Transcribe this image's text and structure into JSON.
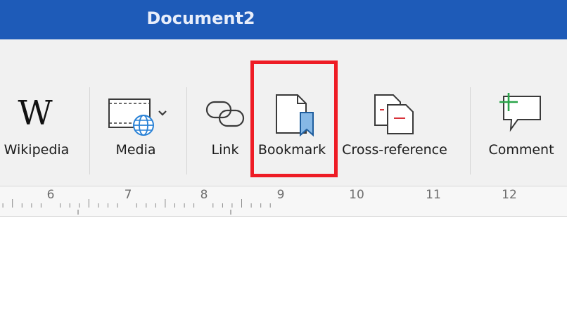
{
  "window": {
    "title": "Document2"
  },
  "ribbon": {
    "buttons": [
      {
        "id": "wikipedia",
        "label": "Wikipedia",
        "icon": "wikipedia-icon",
        "glyph": "W"
      },
      {
        "id": "media",
        "label": "Media",
        "icon": "media-icon"
      },
      {
        "id": "link",
        "label": "Link",
        "icon": "link-icon"
      },
      {
        "id": "bookmark",
        "label": "Bookmark",
        "icon": "bookmark-icon"
      },
      {
        "id": "cross-reference",
        "label": "Cross-reference",
        "icon": "cross-reference-icon"
      },
      {
        "id": "comment",
        "label": "Comment",
        "icon": "comment-icon"
      }
    ]
  },
  "ruler": {
    "numbers": [
      "6",
      "7",
      "8",
      "9",
      "10",
      "11",
      "12"
    ]
  },
  "colors": {
    "titlebar": "#1e5bb8",
    "highlight": "#ee1c25",
    "bookmark_ribbon": "#86b8e6",
    "globe": "#2a82d6",
    "comment_plus": "#2aa54a",
    "cross_ref_mark": "#d8333b"
  }
}
